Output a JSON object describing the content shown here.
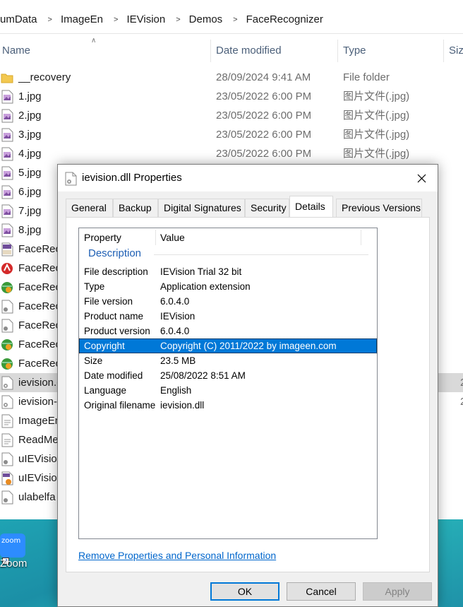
{
  "explorer": {
    "breadcrumb": [
      "umData",
      "ImageEn",
      "IEVision",
      "Demos",
      "FaceRecognizer"
    ],
    "columns": {
      "name": "Name",
      "date_modified": "Date modified",
      "type": "Type",
      "size": "Siz"
    },
    "files": [
      {
        "name": "__recovery",
        "date": "28/09/2024 9:41 AM",
        "type": "File folder",
        "size": "",
        "icon": "folder-icon"
      },
      {
        "name": "1.jpg",
        "date": "23/05/2022 6:00 PM",
        "type": "图片文件(.jpg)",
        "size": "",
        "icon": "jpg-file-icon"
      },
      {
        "name": "2.jpg",
        "date": "23/05/2022 6:00 PM",
        "type": "图片文件(.jpg)",
        "size": "",
        "icon": "jpg-file-icon"
      },
      {
        "name": "3.jpg",
        "date": "23/05/2022 6:00 PM",
        "type": "图片文件(.jpg)",
        "size": "",
        "icon": "jpg-file-icon"
      },
      {
        "name": "4.jpg",
        "date": "23/05/2022 6:00 PM",
        "type": "图片文件(.jpg)",
        "size": "",
        "icon": "jpg-file-icon"
      },
      {
        "name": "5.jpg",
        "date": "",
        "type": "",
        "size": "",
        "icon": "jpg-file-icon"
      },
      {
        "name": "6.jpg",
        "date": "",
        "type": "",
        "size": "",
        "icon": "jpg-file-icon"
      },
      {
        "name": "7.jpg",
        "date": "",
        "type": "",
        "size": "",
        "icon": "jpg-file-icon"
      },
      {
        "name": "8.jpg",
        "date": "",
        "type": "",
        "size": "",
        "icon": "jpg-file-icon"
      },
      {
        "name": "FaceReco",
        "date": "",
        "type": "",
        "size": "",
        "icon": "project-file-icon"
      },
      {
        "name": "FaceReco",
        "date": "",
        "type": "",
        "size": "",
        "icon": "delphi-app-icon"
      },
      {
        "name": "FaceReco",
        "date": "",
        "type": "",
        "size": "",
        "icon": "globe-app-icon"
      },
      {
        "name": "FaceReco",
        "date": "",
        "type": "",
        "size": "",
        "icon": "config-file-icon"
      },
      {
        "name": "FaceReco",
        "date": "",
        "type": "",
        "size": "",
        "icon": "config-file-icon"
      },
      {
        "name": "FaceReco",
        "date": "",
        "type": "",
        "size": "",
        "icon": "globe-app-icon"
      },
      {
        "name": "FaceReco",
        "date": "",
        "type": "",
        "size": "",
        "icon": "globe-app-icon"
      },
      {
        "name": "ievision.c",
        "date": "",
        "type": "",
        "size": "2",
        "icon": "dll-file-icon",
        "selected": true
      },
      {
        "name": "ievision-",
        "date": "",
        "type": "",
        "size": "2",
        "icon": "dll-file-icon"
      },
      {
        "name": "ImageEn",
        "date": "",
        "type": "",
        "size": "",
        "icon": "document-icon"
      },
      {
        "name": "ReadMe",
        "date": "",
        "type": "",
        "size": "",
        "icon": "document-icon"
      },
      {
        "name": "uIEVision",
        "date": "",
        "type": "",
        "size": "",
        "icon": "config-file-icon"
      },
      {
        "name": "uIEVision",
        "date": "",
        "type": "",
        "size": "",
        "icon": "pas-file-icon"
      },
      {
        "name": "ulabelfa",
        "date": "",
        "type": "",
        "size": "",
        "icon": "config-file-icon"
      }
    ]
  },
  "desktop": {
    "zoom_icon_text": "zoom",
    "zoom_label": "Zoom"
  },
  "dialog": {
    "title": "ievision.dll Properties",
    "tabs": [
      {
        "label": "General",
        "active": false
      },
      {
        "label": "Backup",
        "active": false
      },
      {
        "label": "Digital Signatures",
        "active": false
      },
      {
        "label": "Security",
        "active": false
      },
      {
        "label": "Details",
        "active": true
      },
      {
        "label": "Previous Versions",
        "active": false
      }
    ],
    "list_header": {
      "property": "Property",
      "value": "Value"
    },
    "group": "Description",
    "properties": [
      {
        "key": "File description",
        "value": "IEVision Trial 32 bit"
      },
      {
        "key": "Type",
        "value": "Application extension"
      },
      {
        "key": "File version",
        "value": "6.0.4.0"
      },
      {
        "key": "Product name",
        "value": "IEVision"
      },
      {
        "key": "Product version",
        "value": "6.0.4.0"
      },
      {
        "key": "Copyright",
        "value": "Copyright (C) 2011/2022 by imageen.com",
        "selected": true
      },
      {
        "key": "Size",
        "value": "23.5 MB"
      },
      {
        "key": "Date modified",
        "value": "25/08/2022 8:51 AM"
      },
      {
        "key": "Language",
        "value": "English"
      },
      {
        "key": "Original filename",
        "value": "ievision.dll"
      }
    ],
    "remove_link": "Remove Properties and Personal Information",
    "buttons": {
      "ok": "OK",
      "cancel": "Cancel",
      "apply": "Apply"
    }
  },
  "colors": {
    "selection": "#0078d7",
    "link": "#0066cc",
    "group_header": "#1e5fb4"
  }
}
